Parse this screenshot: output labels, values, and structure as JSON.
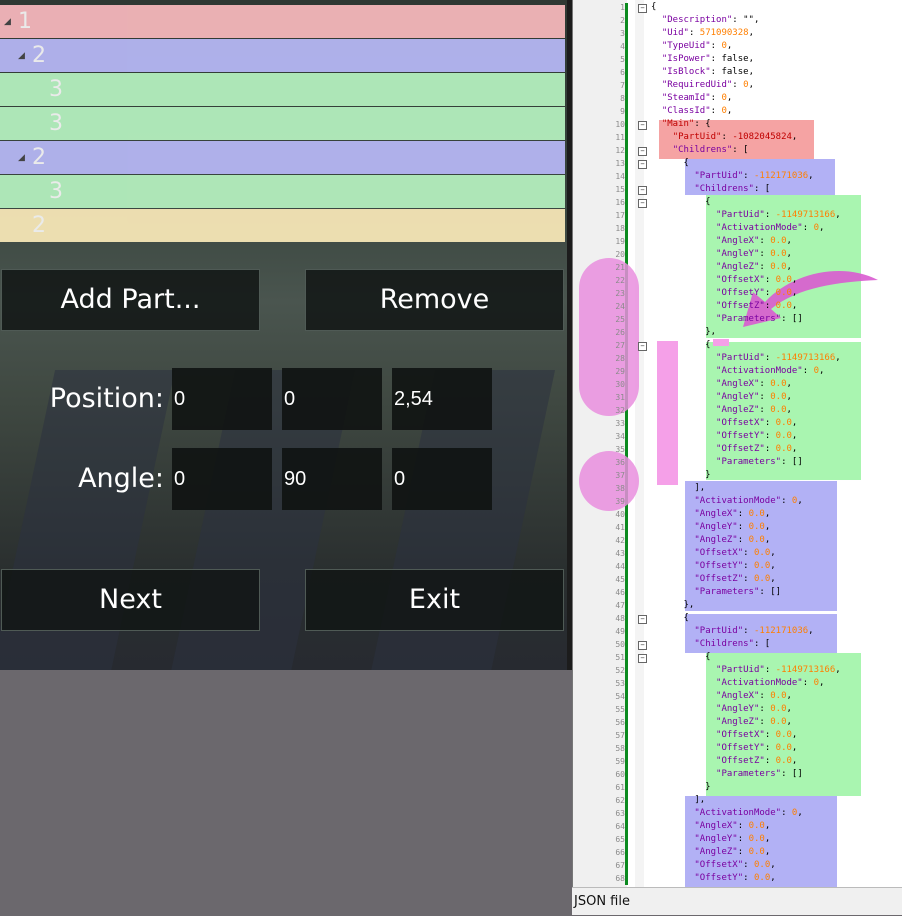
{
  "tree": [
    {
      "label": "1",
      "color": "#f4b6bb",
      "indent": 0,
      "expanded": true
    },
    {
      "label": "2",
      "color": "#b5b6f3",
      "indent": 1,
      "expanded": true
    },
    {
      "label": "3",
      "color": "#b4efbe",
      "indent": 2,
      "expanded": false
    },
    {
      "label": "3",
      "color": "#b4efbe",
      "indent": 2,
      "expanded": false
    },
    {
      "label": "2",
      "color": "#b5b6f3",
      "indent": 1,
      "expanded": true
    },
    {
      "label": "3",
      "color": "#b4efbe",
      "indent": 2,
      "expanded": false
    },
    {
      "label": "2",
      "color": "#f6e6b6",
      "indent": 1,
      "expanded": false
    }
  ],
  "buttons": {
    "add": "Add Part...",
    "remove": "Remove",
    "next": "Next",
    "exit": "Exit"
  },
  "position": {
    "label": "Position:",
    "x": "0",
    "y": "0",
    "z": "2,54"
  },
  "angle": {
    "label": "Angle:",
    "x": "0",
    "y": "90",
    "z": "0"
  },
  "status": "JSON file",
  "colors": {
    "green": "#a9f5b0",
    "blue": "#b2b1f5",
    "red": "#f5a3a3",
    "pink": "#f5a0e8",
    "gutter": "#f0f0f0"
  },
  "code_lines": [
    "{",
    "  \"Description\": \"\",",
    "  \"Uid\": 571090328,",
    "  \"TypeUid\": 0,",
    "  \"IsPower\": false,",
    "  \"IsBlock\": false,",
    "  \"RequiredUid\": 0,",
    "  \"SteamId\": 0,",
    "  \"ClassId\": 0,",
    "  \"Main\": {",
    "    \"PartUid\": -1082045824,",
    "    \"Childrens\": [",
    "      {",
    "        \"PartUid\": -112171036,",
    "        \"Childrens\": [",
    "          {",
    "            \"PartUid\": -1149713166,",
    "            \"ActivationMode\": 0,",
    "            \"AngleX\": 0.0,",
    "            \"AngleY\": 0.0,",
    "            \"AngleZ\": 0.0,",
    "            \"OffsetX\": 0.0,",
    "            \"OffsetY\": 0.0,",
    "            \"OffsetZ\": 0.0,",
    "            \"Parameters\": []",
    "          },",
    "          {",
    "            \"PartUid\": -1149713166,",
    "            \"ActivationMode\": 0,",
    "            \"AngleX\": 0.0,",
    "            \"AngleY\": 0.0,",
    "            \"AngleZ\": 0.0,",
    "            \"OffsetX\": 0.0,",
    "            \"OffsetY\": 0.0,",
    "            \"OffsetZ\": 0.0,",
    "            \"Parameters\": []",
    "          }",
    "        ],",
    "        \"ActivationMode\": 0,",
    "        \"AngleX\": 0.0,",
    "        \"AngleY\": 0.0,",
    "        \"AngleZ\": 0.0,",
    "        \"OffsetX\": 0.0,",
    "        \"OffsetY\": 0.0,",
    "        \"OffsetZ\": 0.0,",
    "        \"Parameters\": []",
    "      },",
    "      {",
    "        \"PartUid\": -112171036,",
    "        \"Childrens\": [",
    "          {",
    "            \"PartUid\": -1149713166,",
    "            \"ActivationMode\": 0,",
    "            \"AngleX\": 0.0,",
    "            \"AngleY\": 0.0,",
    "            \"AngleZ\": 0.0,",
    "            \"OffsetX\": 0.0,",
    "            \"OffsetY\": 0.0,",
    "            \"OffsetZ\": 0.0,",
    "            \"Parameters\": []",
    "          }",
    "        ],",
    "        \"ActivationMode\": 0,",
    "        \"AngleX\": 0.0,",
    "        \"AngleY\": 0.0,",
    "        \"AngleZ\": 0.0,",
    "        \"OffsetX\": 0.0,",
    "        \"OffsetY\": 0.0,"
  ]
}
